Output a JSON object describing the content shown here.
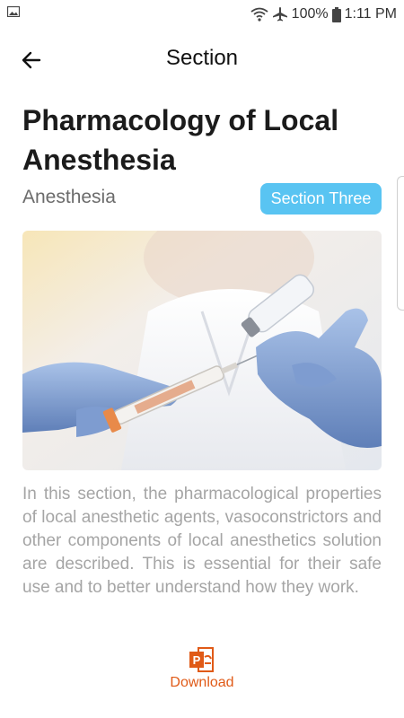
{
  "status_bar": {
    "battery_percent": "100%",
    "time": "1:11 PM",
    "icons": [
      "image-icon",
      "wifi-icon",
      "airplane-icon",
      "battery-icon"
    ]
  },
  "app_bar": {
    "title": "Section",
    "back_icon": "arrow-left-icon"
  },
  "article": {
    "title": "Pharmacology of Local Anesthesia",
    "category": "Anesthesia",
    "section_badge": "Section Three",
    "image": "gloved hands drawing liquid from a vial with a syringe",
    "description": "In this section, the pharmacological properties of local anesthetic agents, vasoconstrictors and other components of local anesthetics solution are described. This is essential for their safe use and to better understand how they work."
  },
  "download": {
    "label": "Download",
    "icon": "powerpoint-file-icon"
  },
  "colors": {
    "badge_bg": "#59c4f2",
    "download_accent": "#e05a17",
    "text_muted": "#a5a5a5"
  }
}
